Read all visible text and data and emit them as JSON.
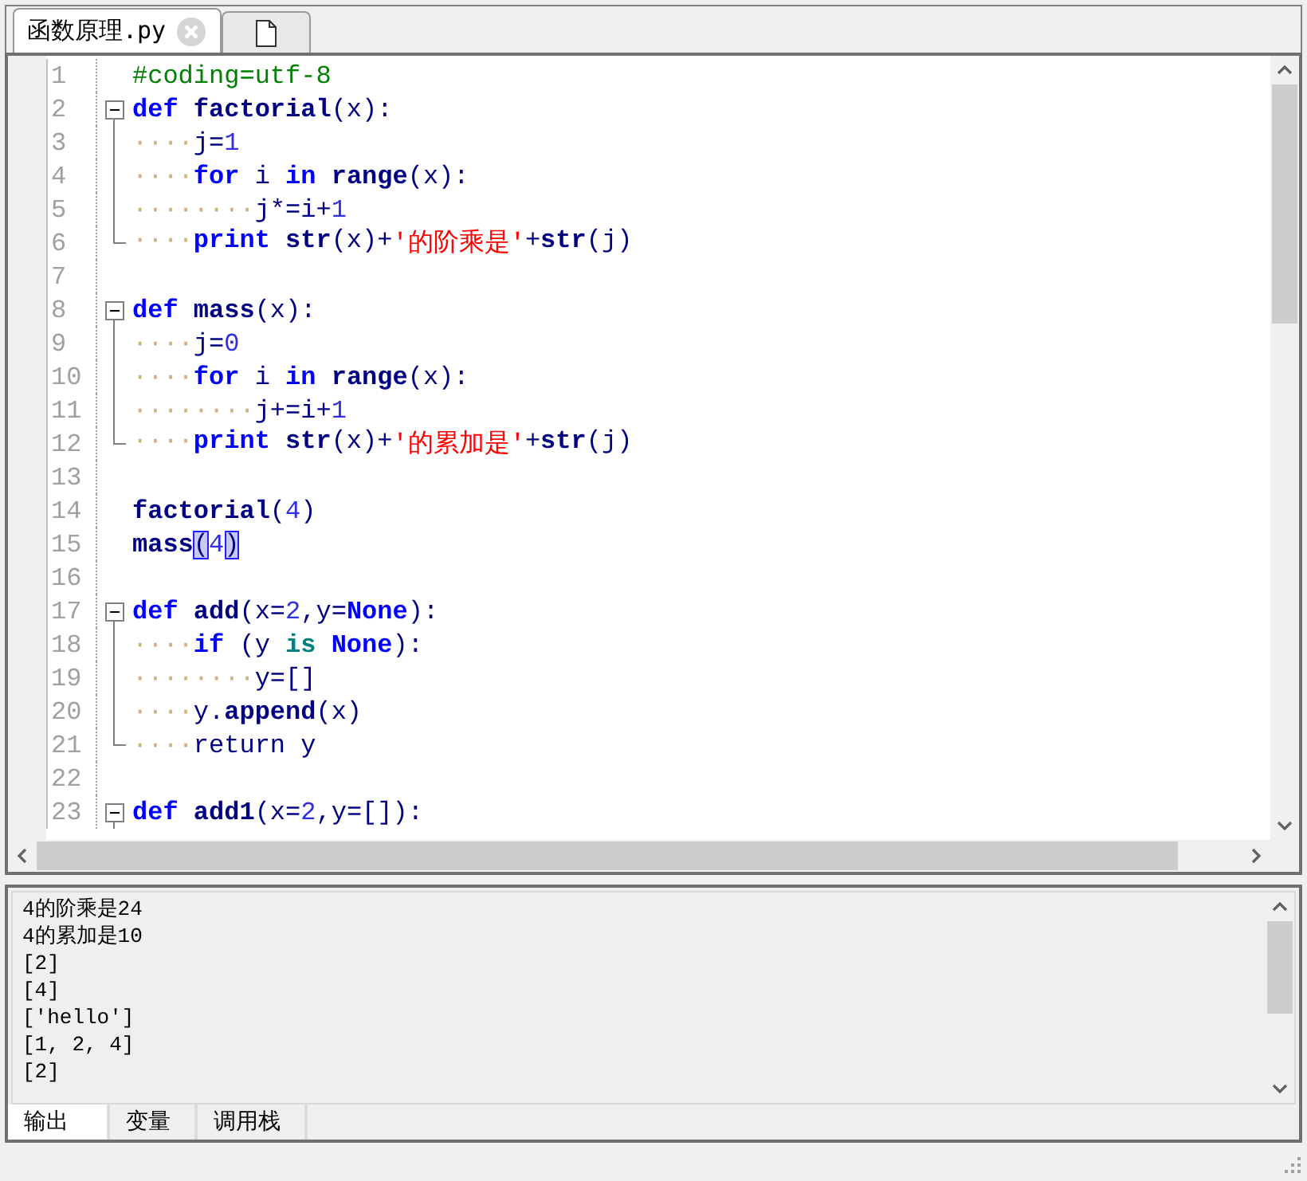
{
  "tabs": [
    {
      "kind": "document",
      "label": "函数原理.py",
      "selected": true
    },
    {
      "kind": "new",
      "selected": false
    }
  ],
  "editor": {
    "lines": [
      {
        "number": "1",
        "kind": "plain",
        "tokens": [
          {
            "kind": "comment",
            "text": "#coding=utf-8"
          }
        ]
      },
      {
        "number": "2",
        "kind": "start",
        "tokens": [
          {
            "kind": "keyword",
            "text": "def"
          },
          {
            "kind": "name",
            "text": " factorial"
          },
          {
            "kind": "plain",
            "text": "(x):"
          }
        ]
      },
      {
        "number": "3",
        "kind": "body",
        "tokens": [
          {
            "kind": "space",
            "text": "····"
          },
          {
            "kind": "plain",
            "text": "j="
          },
          {
            "kind": "number",
            "text": "1"
          }
        ]
      },
      {
        "number": "4",
        "kind": "body",
        "tokens": [
          {
            "kind": "space",
            "text": "····"
          },
          {
            "kind": "keyword",
            "text": "for"
          },
          {
            "kind": "plain",
            "text": " i "
          },
          {
            "kind": "keyword",
            "text": "in"
          },
          {
            "kind": "name",
            "text": " range"
          },
          {
            "kind": "plain",
            "text": "(x):"
          }
        ]
      },
      {
        "number": "5",
        "kind": "body",
        "tokens": [
          {
            "kind": "space",
            "text": "········"
          },
          {
            "kind": "plain",
            "text": "j*=i+"
          },
          {
            "kind": "number",
            "text": "1"
          }
        ]
      },
      {
        "number": "6",
        "kind": "end",
        "tokens": [
          {
            "kind": "space",
            "text": "····"
          },
          {
            "kind": "keyword",
            "text": "print"
          },
          {
            "kind": "name",
            "text": " str"
          },
          {
            "kind": "plain",
            "text": "(x)+"
          },
          {
            "kind": "string",
            "text": "'的阶乘是'"
          },
          {
            "kind": "plain",
            "text": "+"
          },
          {
            "kind": "name",
            "text": "str"
          },
          {
            "kind": "plain",
            "text": "(j)"
          }
        ]
      },
      {
        "number": "7",
        "kind": "plain"
      },
      {
        "number": "8",
        "kind": "start",
        "tokens": [
          {
            "kind": "keyword",
            "text": "def"
          },
          {
            "kind": "name",
            "text": " mass"
          },
          {
            "kind": "plain",
            "text": "(x):"
          }
        ]
      },
      {
        "number": "9",
        "kind": "body",
        "tokens": [
          {
            "kind": "space",
            "text": "····"
          },
          {
            "kind": "plain",
            "text": "j="
          },
          {
            "kind": "number",
            "text": "0"
          }
        ]
      },
      {
        "number": "10",
        "kind": "body",
        "tokens": [
          {
            "kind": "space",
            "text": "····"
          },
          {
            "kind": "keyword",
            "text": "for"
          },
          {
            "kind": "plain",
            "text": " i "
          },
          {
            "kind": "keyword",
            "text": "in"
          },
          {
            "kind": "name",
            "text": " range"
          },
          {
            "kind": "plain",
            "text": "(x):"
          }
        ]
      },
      {
        "number": "11",
        "kind": "body",
        "tokens": [
          {
            "kind": "space",
            "text": "········"
          },
          {
            "kind": "plain",
            "text": "j+=i+"
          },
          {
            "kind": "number",
            "text": "1"
          }
        ]
      },
      {
        "number": "12",
        "kind": "end",
        "tokens": [
          {
            "kind": "space",
            "text": "····"
          },
          {
            "kind": "keyword",
            "text": "print"
          },
          {
            "kind": "name",
            "text": " str"
          },
          {
            "kind": "plain",
            "text": "(x)+"
          },
          {
            "kind": "string",
            "text": "'的累加是'"
          },
          {
            "kind": "plain",
            "text": "+"
          },
          {
            "kind": "name",
            "text": "str"
          },
          {
            "kind": "plain",
            "text": "(j)"
          }
        ]
      },
      {
        "number": "13",
        "kind": "plain"
      },
      {
        "number": "14",
        "kind": "plain",
        "tokens": [
          {
            "kind": "name",
            "text": "factorial"
          },
          {
            "kind": "plain",
            "text": "("
          },
          {
            "kind": "number",
            "text": "4"
          },
          {
            "kind": "plain",
            "text": ")"
          }
        ]
      },
      {
        "number": "15",
        "kind": "plain",
        "tokens": [
          {
            "kind": "name",
            "text": "mass"
          },
          {
            "kind": "brace",
            "text": "("
          },
          {
            "kind": "number",
            "text": "4"
          },
          {
            "kind": "brace",
            "text": ")"
          }
        ]
      },
      {
        "number": "16",
        "kind": "plain"
      },
      {
        "number": "17",
        "kind": "start",
        "tokens": [
          {
            "kind": "keyword",
            "text": "def"
          },
          {
            "kind": "name",
            "text": " add"
          },
          {
            "kind": "plain",
            "text": "(x="
          },
          {
            "kind": "number",
            "text": "2"
          },
          {
            "kind": "plain",
            "text": ",y="
          },
          {
            "kind": "keyword",
            "text": "None"
          },
          {
            "kind": "plain",
            "text": "):"
          }
        ]
      },
      {
        "number": "18",
        "kind": "body",
        "tokens": [
          {
            "kind": "space",
            "text": "····"
          },
          {
            "kind": "keyword",
            "text": "if"
          },
          {
            "kind": "plain",
            "text": " (y "
          },
          {
            "kind": "operator",
            "text": "is"
          },
          {
            "kind": "keyword",
            "text": " None"
          },
          {
            "kind": "plain",
            "text": "):"
          }
        ]
      },
      {
        "number": "19",
        "kind": "body",
        "tokens": [
          {
            "kind": "space",
            "text": "········"
          },
          {
            "kind": "plain",
            "text": "y=[]"
          }
        ]
      },
      {
        "number": "20",
        "kind": "body",
        "tokens": [
          {
            "kind": "space",
            "text": "····"
          },
          {
            "kind": "plain",
            "text": "y."
          },
          {
            "kind": "name",
            "text": "append"
          },
          {
            "kind": "plain",
            "text": "(x)"
          }
        ]
      },
      {
        "number": "21",
        "kind": "end",
        "tokens": [
          {
            "kind": "space",
            "text": "····"
          },
          {
            "kind": "plain",
            "text": "return y"
          }
        ]
      },
      {
        "number": "22",
        "kind": "plain"
      },
      {
        "number": "23",
        "kind": "start",
        "tokens": [
          {
            "kind": "keyword",
            "text": "def"
          },
          {
            "kind": "name",
            "text": " add1"
          },
          {
            "kind": "plain",
            "text": "(x="
          },
          {
            "kind": "number",
            "text": "2"
          },
          {
            "kind": "plain",
            "text": ",y=[]):"
          }
        ]
      }
    ]
  },
  "output": {
    "lines": [
      "4的阶乘是24",
      "4的累加是10",
      "[2]",
      "[4]",
      "['hello']",
      "[1, 2, 4]",
      "[2]"
    ]
  },
  "panel_tabs": [
    {
      "label": "输出",
      "selected": true
    },
    {
      "label": "变量",
      "selected": false
    },
    {
      "label": "调用栈",
      "selected": false
    }
  ]
}
